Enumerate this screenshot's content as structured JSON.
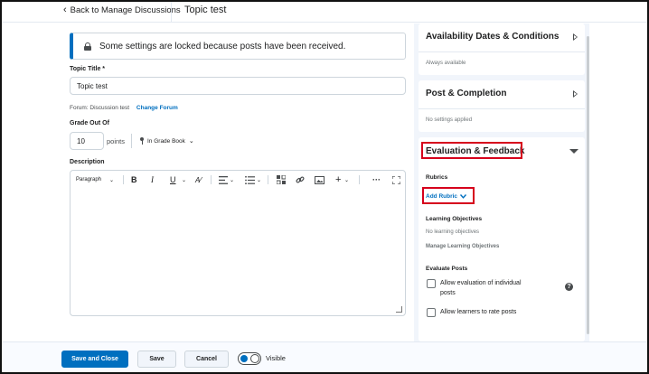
{
  "topbar": {
    "back_label": "Back to Manage Discussions",
    "title": "Topic test"
  },
  "alert": {
    "text": "Some settings are locked because posts have been received."
  },
  "topic": {
    "title_label": "Topic Title *",
    "title_value": "Topic test",
    "forum_prefix": "Forum: Discussion test",
    "change_forum": "Change Forum"
  },
  "grade": {
    "label": "Grade Out Of",
    "value": "10",
    "unit": "points",
    "gradebook": "In Grade Book"
  },
  "description": {
    "label": "Description",
    "toolbar": {
      "format": "Paragraph",
      "bold": "B",
      "italic": "I",
      "underline": "U",
      "more": "···",
      "add": "+"
    }
  },
  "right_panel": {
    "availability": {
      "title": "Availability Dates & Conditions",
      "subtitle": "Always available"
    },
    "post_completion": {
      "title": "Post & Completion",
      "subtitle": "No settings applied"
    },
    "evaluation": {
      "title": "Evaluation & Feedback",
      "rubrics_label": "Rubrics",
      "add_rubric": "Add Rubric",
      "objectives_label": "Learning Objectives",
      "objectives_value": "No learning objectives",
      "manage_objectives": "Manage Learning Objectives",
      "evaluate_label": "Evaluate Posts",
      "allow_eval_line1": "Allow evaluation of individual",
      "allow_eval_line2": "posts",
      "allow_rate": "Allow learners to rate posts",
      "help": "?"
    }
  },
  "footer": {
    "save_close": "Save and Close",
    "save": "Save",
    "cancel": "Cancel",
    "visible": "Visible"
  },
  "colors": {
    "accent": "#006fbf",
    "highlight": "#d6001c"
  }
}
